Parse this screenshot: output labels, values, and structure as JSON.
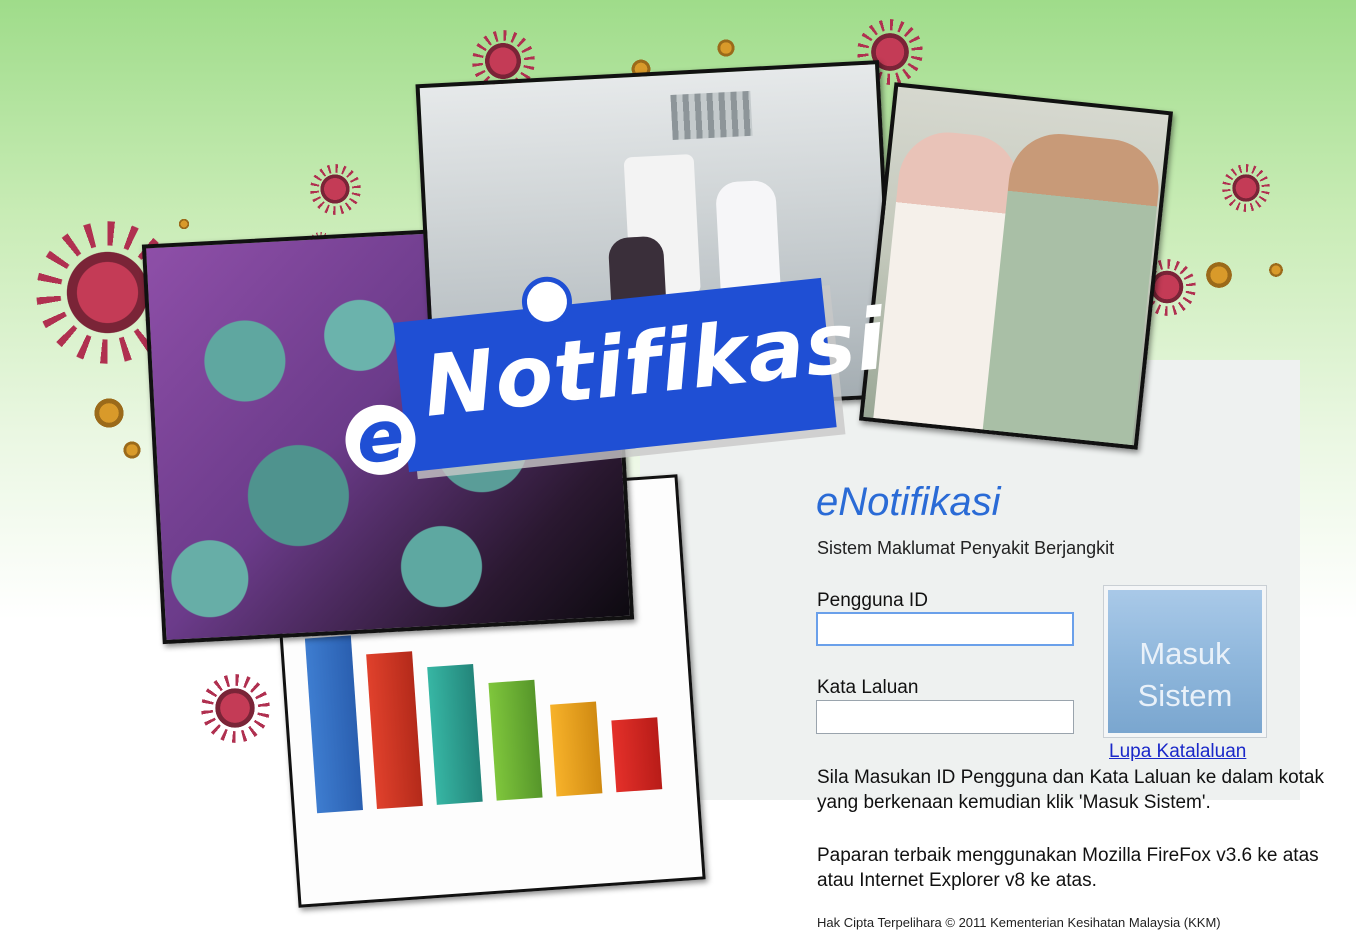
{
  "logo": {
    "text": "Notifikasi",
    "prefix": "e"
  },
  "login": {
    "title": "eNotifikasi",
    "subtitle": "Sistem Maklumat Penyakit Berjangkit",
    "user_label": "Pengguna ID",
    "user_value": "",
    "password_label": "Kata Laluan",
    "password_value": "",
    "submit_line1": "Masuk",
    "submit_line2": "Sistem",
    "forgot_link": "Lupa Katalaluan",
    "instructions": "Sila Masukan ID Pengguna dan Kata Laluan ke dalam kotak yang berkenaan kemudian klik 'Masuk Sistem'.",
    "browser_note": "Paparan terbaik menggunakan Mozilla FireFox v3.6 ke atas atau Internet Explorer v8 ke atas."
  },
  "footer": {
    "copyright": "Hak Cipta Terpelihara © 2011 Kementerian Kesihatan Malaysia (KKM)"
  },
  "colors": {
    "title_blue": "#2a6bd6",
    "logo_blue": "#1f4fd4",
    "link_blue": "#1a28c9",
    "button_blue": "#8fb7dc"
  }
}
